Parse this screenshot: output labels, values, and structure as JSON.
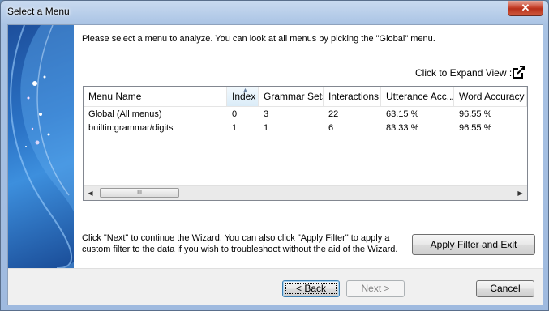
{
  "window": {
    "title": "Select a Menu",
    "close_glyph": "✕"
  },
  "instructions": "Please select a menu to analyze. You can look at all menus by picking the \"Global\" menu.",
  "expand": {
    "label": "Click to Expand View :",
    "icon": "external-link-icon"
  },
  "grid": {
    "columns": [
      "Menu Name",
      "Index",
      "Grammar Sets",
      "Interactions",
      "Utterance Acc...",
      "Word Accuracy"
    ],
    "sorted_column": "Index",
    "rows": [
      [
        "Global (All menus)",
        "0",
        "3",
        "22",
        "63.15 %",
        "96.55 %"
      ],
      [
        "builtin:grammar/digits",
        "1",
        "1",
        "6",
        "83.33 %",
        "96.55 %"
      ]
    ],
    "scroll_left_glyph": "◀",
    "scroll_right_glyph": "▶",
    "scroll_thumb_grip": "III"
  },
  "note": "Click \"Next\" to continue the Wizard. You can also click \"Apply Filter\" to apply a custom filter to the data if you wish to troubleshoot without the aid of the Wizard.",
  "buttons": {
    "apply": "Apply Filter and Exit",
    "back": "< Back",
    "next": "Next >",
    "cancel": "Cancel"
  }
}
